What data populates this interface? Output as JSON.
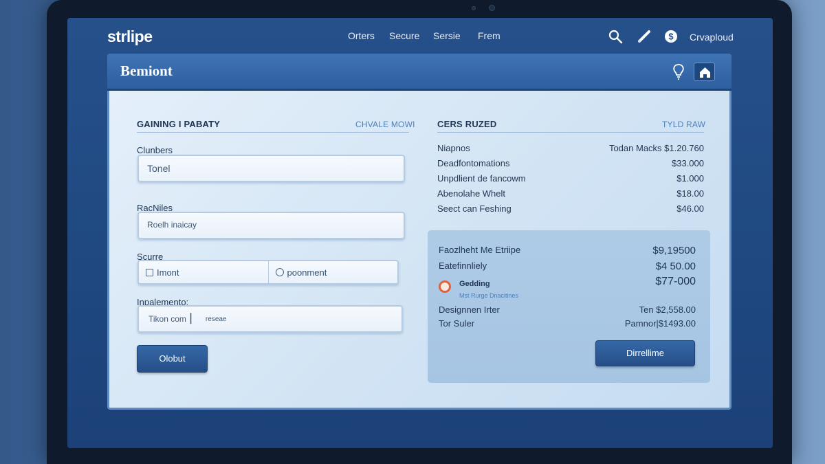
{
  "nav": {
    "logo": "strlipe",
    "links": [
      "Orters",
      "Secure",
      "Sersie",
      "Frem"
    ],
    "icons": [
      "search-icon",
      "pen-icon",
      "dollar-icon"
    ],
    "upload_label": "Crvaploud"
  },
  "header": {
    "title": "Bemiont",
    "icons": [
      "lightbulb-icon",
      "home-icon"
    ]
  },
  "left": {
    "section_title": "GAINING I PABATY",
    "section_link": "CHVALE MOWI",
    "fields": {
      "clunbers": {
        "label": "Clunbers",
        "value": "Tonel"
      },
      "racniles": {
        "label": "RacNiles",
        "value": "Roelh inaicay"
      },
      "scurre": {
        "label": "Scurre",
        "left_value": "Imont",
        "right_value": "poonment"
      },
      "inpalemento": {
        "label": "Inpalemento:",
        "value": "Tikon com",
        "suffix": "reseae"
      }
    },
    "button_label": "Olobut"
  },
  "right": {
    "section_title": "CERS RUZED",
    "section_link": "TYLD RAW",
    "rows": [
      {
        "label": "Niapnos",
        "value": "Todan Macks $1.20.760"
      },
      {
        "label": "Deadfontomations",
        "value": "$33.000"
      },
      {
        "label": "Unpdlient de fancowm",
        "value": "$1.000"
      },
      {
        "label": "Abenolahe Whelt",
        "value": "$18.00"
      },
      {
        "label": "Seect can Feshing",
        "value": "$46.00"
      }
    ],
    "panel": {
      "rows": [
        {
          "label": "Faozlheht Me Etriipe",
          "value": "$9,19500"
        },
        {
          "label": "Eatefinnliely",
          "value": "$4 50.00"
        }
      ],
      "status": {
        "label": "Gedding",
        "sub": "Mst Rurge Dnacitines",
        "value": "$77-000"
      },
      "rows2": [
        {
          "label": "Designnen Irter",
          "value": "Ten $2,558.00"
        },
        {
          "label": "Tor Suler",
          "value": "Pamnor|$1493.00"
        }
      ],
      "button_label": "Dirrellime"
    }
  },
  "colors": {
    "accent": "#2e5f9f",
    "screen": "#26508a",
    "card": "#dceaf6",
    "panel": "#aecbe6",
    "status_ring": "#e0633e"
  }
}
